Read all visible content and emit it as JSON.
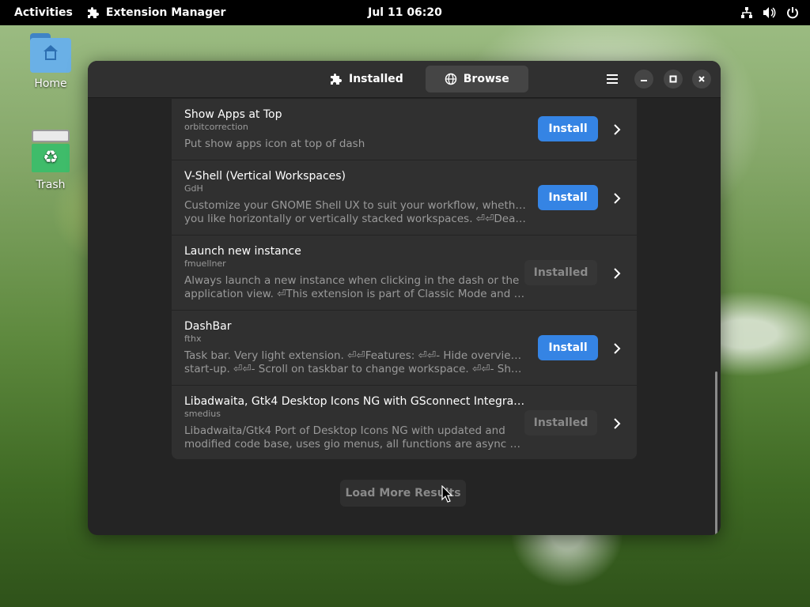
{
  "topbar": {
    "activities": "Activities",
    "app_name": "Extension Manager",
    "clock": "Jul 11  06:20",
    "tray_icons": [
      "network-icon",
      "volume-icon",
      "power-icon"
    ]
  },
  "desktop": {
    "items": [
      {
        "label": "Home",
        "icon": "home-folder-icon"
      },
      {
        "label": "Trash",
        "icon": "trash-icon"
      }
    ]
  },
  "window": {
    "tabs": [
      {
        "label": "Installed",
        "icon": "puzzle-icon",
        "active": false
      },
      {
        "label": "Browse",
        "icon": "globe-icon",
        "active": true
      }
    ],
    "extensions": [
      {
        "title": "Show Apps at Top",
        "author": "orbitcorrection",
        "desc1": "Put show apps icon at top of dash",
        "desc2": "",
        "action": "Install"
      },
      {
        "title": "V-Shell (Vertical Workspaces)",
        "author": "GdH",
        "desc1": "Customize your GNOME Shell UX to suit your workflow, whether",
        "desc2": "you like horizontally or vertically stacked workspaces. ⏎⏎Dear users, if you want to",
        "action": "Install"
      },
      {
        "title": "Launch new instance",
        "author": "fmuellner",
        "desc1": "Always launch a new instance when clicking in the dash or the",
        "desc2": "application view. ⏎This extension is part of Classic Mode and is officially supported",
        "action": "Installed"
      },
      {
        "title": "DashBar",
        "author": "fthx",
        "desc1": "Task bar. Very light extension. ⏎⏎Features: ⏎⏎- Hide overview at",
        "desc2": "start-up. ⏎⏎- Scroll on taskbar to change workspace. ⏎⏎- Show windows",
        "action": "Install"
      },
      {
        "title": "Libadwaita, Gtk4 Desktop Icons NG with GSconnect Integration and Drag and Drop",
        "author": "smedius",
        "desc1": "Libadwaita/Gtk4 Port of Desktop Icons NG with updated and",
        "desc2": "modified code base, uses gio menus, all functions are async with promises",
        "action": "Installed"
      }
    ],
    "load_more": "Load More Results",
    "colors": {
      "accent": "#3584e4",
      "window_bg": "#242424",
      "row_bg": "#303030"
    }
  }
}
